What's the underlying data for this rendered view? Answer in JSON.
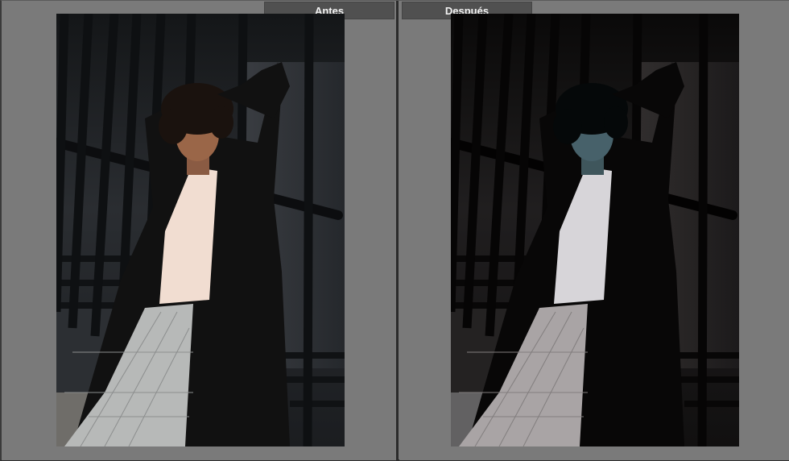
{
  "comparison": {
    "before_label": "Antes",
    "after_label": "Después"
  },
  "colors": {
    "background": "#7b7b7b",
    "tab": "#505050",
    "tab_text": "#f2f2f2",
    "divider": "#2b2b2b"
  },
  "icons": {
    "photo": "portrait-photo"
  }
}
